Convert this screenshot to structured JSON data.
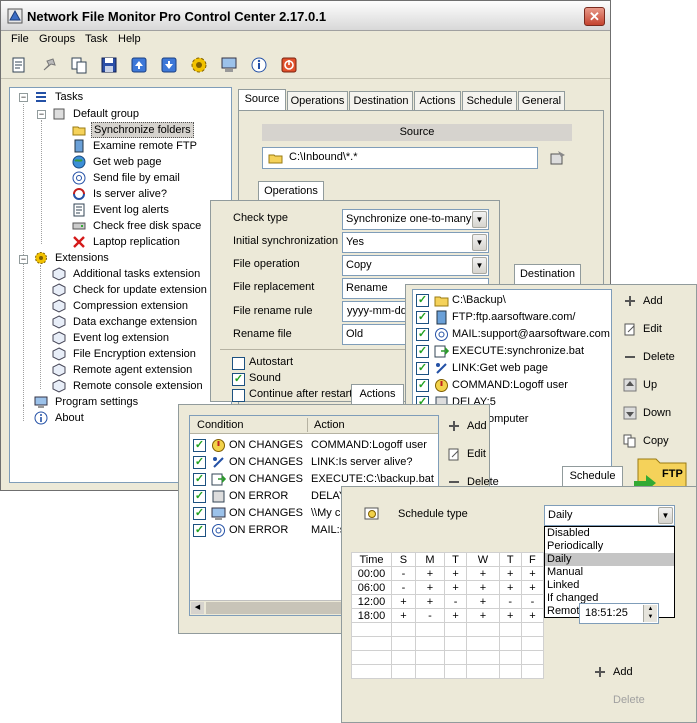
{
  "window": {
    "title": "Network File Monitor Pro Control Center 2.17.0.1",
    "close_glyph": "✕"
  },
  "menu": [
    "File",
    "Groups",
    "Task",
    "Help"
  ],
  "toolbar": [
    "new-task-icon",
    "pin-icon",
    "copy-icon",
    "save-icon",
    "upload-icon",
    "download-icon",
    "settings-gear-icon",
    "computer-icon",
    "info-icon",
    "power-icon"
  ],
  "tree": {
    "tasks": "Tasks",
    "default_group": "Default group",
    "items": [
      "Synchronize folders",
      "Examine remote FTP",
      "Get web page",
      "Send file by email",
      "Is server alive?",
      "Event log alerts",
      "Check free disk space",
      "Laptop replication"
    ],
    "extensions": "Extensions",
    "ext_items": [
      "Additional tasks extension",
      "Check for update extension",
      "Compression extension",
      "Data exchange extension",
      "Event log extension",
      "File Encryption extension",
      "Remote agent extension",
      "Remote console extension"
    ],
    "program_settings": "Program settings",
    "about": "About"
  },
  "tabs": [
    "Source",
    "Operations",
    "Destination",
    "Actions",
    "Schedule",
    "General"
  ],
  "source": {
    "title": "Source",
    "path": "C:\\Inbound\\*.*"
  },
  "operations": {
    "tab": "Operations",
    "fields": [
      {
        "label": "Check type",
        "value": "Synchronize one-to-many"
      },
      {
        "label": "Initial synchronization",
        "value": "Yes"
      },
      {
        "label": "File operation",
        "value": "Copy"
      },
      {
        "label": "File replacement",
        "value": "Rename"
      },
      {
        "label": "File rename rule",
        "value": "yyyy-mm-dd_"
      },
      {
        "label": "Rename file",
        "value": "Old"
      }
    ],
    "checks": [
      {
        "label": "Autostart",
        "checked": false
      },
      {
        "label": "Sound",
        "checked": true
      },
      {
        "label": "Continue after restart",
        "checked": false
      }
    ]
  },
  "destination": {
    "tab": "Destination",
    "items": [
      "C:\\Backup\\",
      "FTP:ftp.aarsoftware.com/",
      "MAIL:support@aarsoftware.com",
      "EXECUTE:synchronize.bat",
      "LINK:Get web page",
      "COMMAND:Logoff user",
      "DELAY:5",
      "omputer"
    ],
    "buttons": [
      "Add",
      "Edit",
      "Delete",
      "Up",
      "Down",
      "Copy"
    ],
    "ftp_badge": "FTP"
  },
  "actions": {
    "tab": "Actions",
    "headers": [
      "Condition",
      "Action"
    ],
    "rows": [
      {
        "condition": "ON CHANGES",
        "action": "COMMAND:Logoff user"
      },
      {
        "condition": "ON CHANGES",
        "action": "LINK:Is server alive?"
      },
      {
        "condition": "ON CHANGES",
        "action": "EXECUTE:C:\\backup.bat"
      },
      {
        "condition": "ON ERROR",
        "action": "DELAY"
      },
      {
        "condition": "ON CHANGES",
        "action": "\\\\My c"
      },
      {
        "condition": "ON ERROR",
        "action": "MAIL:s"
      }
    ],
    "buttons": [
      "Add",
      "Edit",
      "Delete"
    ]
  },
  "schedule": {
    "tab": "Schedule",
    "type_label": "Schedule type",
    "selected": "Daily",
    "options": [
      "Disabled",
      "Periodically",
      "Daily",
      "Manual",
      "Linked",
      "If changed",
      "Remote request"
    ],
    "headers": [
      "Time",
      "S",
      "M",
      "T",
      "W",
      "T",
      "F"
    ],
    "rows": [
      {
        "time": "00:00",
        "cells": [
          "-",
          "+",
          "+",
          "+",
          "+",
          "+"
        ]
      },
      {
        "time": "06:00",
        "cells": [
          "-",
          "+",
          "+",
          "+",
          "+",
          "+"
        ]
      },
      {
        "time": "12:00",
        "cells": [
          "+",
          "+",
          "-",
          "+",
          "-",
          "-"
        ]
      },
      {
        "time": "18:00",
        "cells": [
          "+",
          "-",
          "+",
          "+",
          "+",
          "+"
        ]
      }
    ],
    "time_value": "18:51:25",
    "add": "Add",
    "delete": "Delete"
  }
}
